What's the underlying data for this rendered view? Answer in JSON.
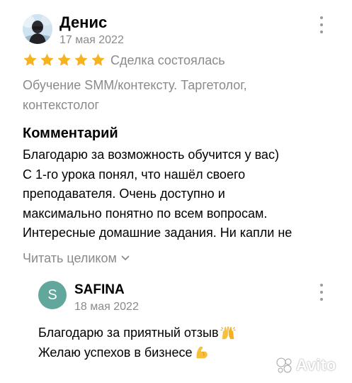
{
  "review": {
    "author_name": "Денис",
    "date": "17 мая 2022",
    "rating": 5,
    "deal_status": "Сделка состоялась",
    "category": "Обучение SMM/контексту. Таргетолог, контекстолог",
    "comment_heading": "Комментарий",
    "comment_lines": [
      "Благодарю за возможность обучится у вас)",
      "С 1-го урока понял, что нашёл своего",
      "преподавателя. Очень доступно и",
      "максимально понятно по всем вопросам.",
      "Интересные домашние задания. Ни капли не"
    ],
    "read_more_label": "Читать целиком"
  },
  "reply": {
    "avatar_letter": "S",
    "author_name": "SAFINA",
    "date": "18 мая 2022",
    "lines": [
      "Благодарю за приятный отзыв",
      "Желаю успехов в бизнесе"
    ]
  },
  "watermark": {
    "text": "Avito"
  },
  "colors": {
    "star": "#f5b324",
    "secondary_text": "#8a8a8a",
    "reply_avatar": "#62a79b"
  },
  "icons": {
    "review_menu": "more-vertical-icon",
    "reply_menu": "more-vertical-icon",
    "read_more": "chevron-down-icon",
    "star": "star-icon",
    "reply_line1_emoji": "raising-hands-emoji",
    "reply_line2_emoji": "flexed-biceps-emoji"
  }
}
